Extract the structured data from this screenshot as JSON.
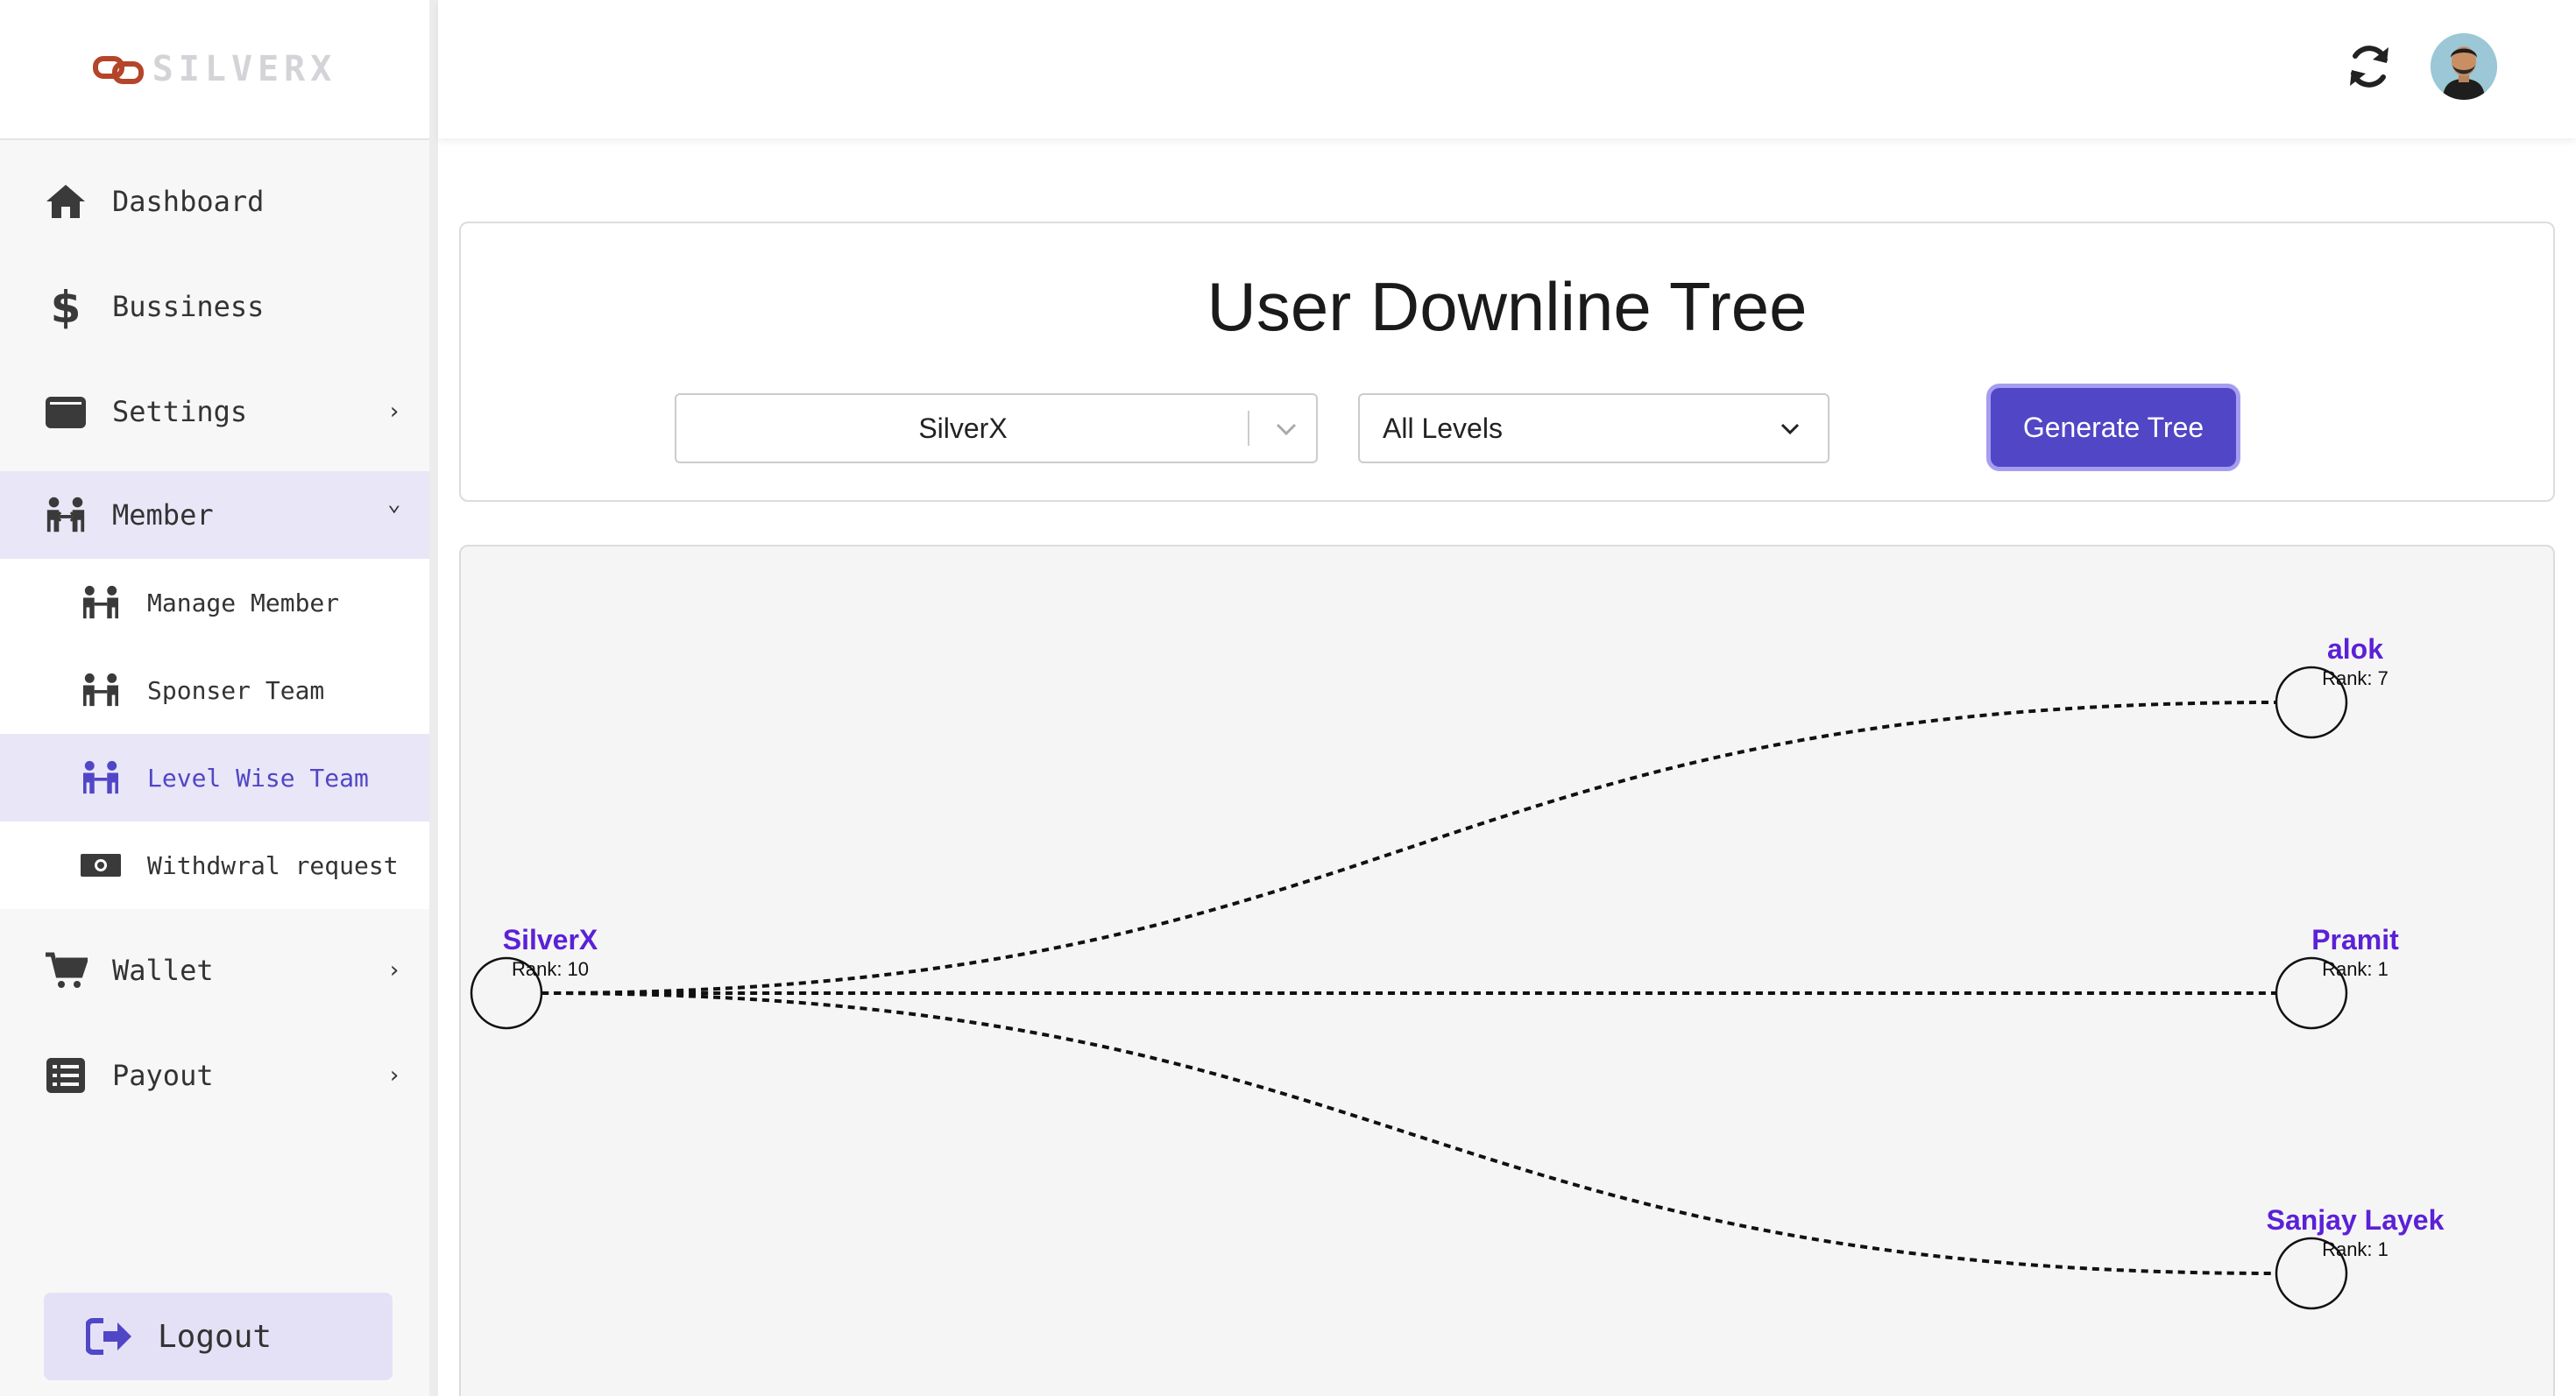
{
  "sidebar": {
    "logo_text": "SILVERX",
    "items": [
      {
        "label": "Dashboard",
        "icon": "home-icon"
      },
      {
        "label": "Bussiness",
        "icon": "dollar-icon"
      },
      {
        "label": "Settings",
        "icon": "wallet-icon",
        "chevron": "›"
      },
      {
        "label": "Member",
        "icon": "people-icon",
        "chevron": "⌄"
      }
    ],
    "member_sub": [
      {
        "label": "Manage Member",
        "icon": "people-icon"
      },
      {
        "label": "Sponser Team",
        "icon": "people-icon"
      },
      {
        "label": "Level Wise Team",
        "icon": "people-icon"
      },
      {
        "label": "Withdwral request",
        "icon": "money-icon"
      }
    ],
    "items_after": [
      {
        "label": "Wallet",
        "icon": "cart-icon",
        "chevron": "›"
      },
      {
        "label": "Payout",
        "icon": "list-icon",
        "chevron": "›"
      }
    ],
    "logout_label": "Logout"
  },
  "header": {
    "refresh_icon": "refresh-icon",
    "avatar_icon": "user-avatar"
  },
  "form": {
    "title": "User Downline Tree",
    "user_select_value": "SilverX",
    "level_select_value": "All Levels",
    "generate_label": "Generate Tree"
  },
  "tree": {
    "root": {
      "name": "SilverX",
      "rank": "Rank: 10"
    },
    "children": [
      {
        "name": "alok",
        "rank": "Rank: 7"
      },
      {
        "name": "Pramit",
        "rank": "Rank: 1"
      },
      {
        "name": "Sanjay Layek",
        "rank": "Rank: 1"
      }
    ]
  },
  "colors": {
    "accent": "#5146c6",
    "node_name": "#5b21d6",
    "active_bg": "#e9e6f8"
  }
}
